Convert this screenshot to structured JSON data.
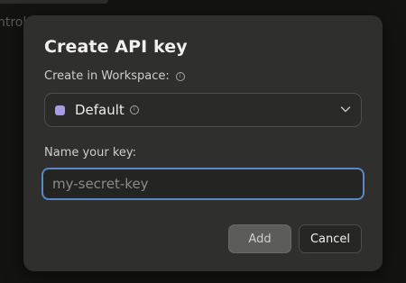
{
  "backdrop": {
    "partial_text": "ntrol"
  },
  "dialog": {
    "title": "Create API key",
    "workspace_label": "Create in Workspace:",
    "workspace": {
      "value": "Default",
      "color": "#a89be6"
    },
    "name_label": "Name your key:",
    "name_input": {
      "value": "",
      "placeholder": "my-secret-key"
    },
    "buttons": {
      "add": "Add",
      "cancel": "Cancel"
    }
  },
  "icons": {
    "info": "info-icon",
    "chevron": "chevron-down-icon",
    "workspace_swatch": "workspace-color-swatch"
  }
}
